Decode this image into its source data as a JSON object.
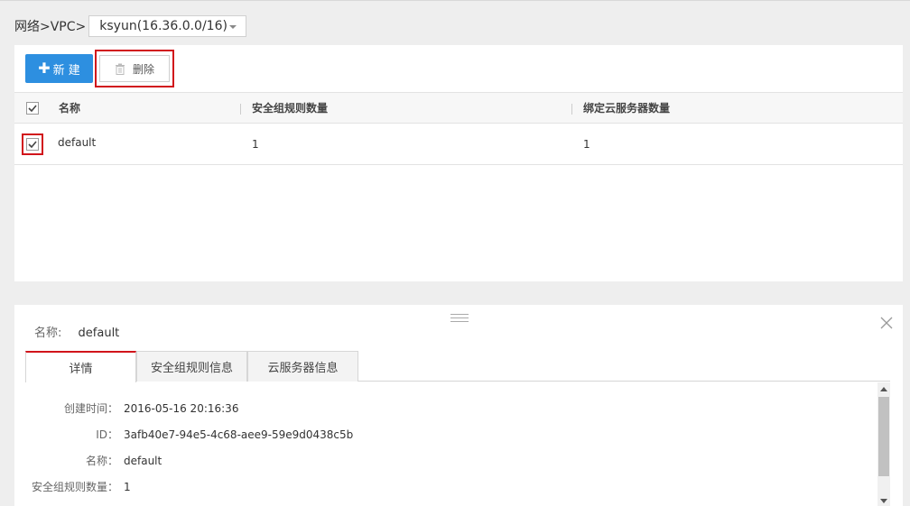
{
  "breadcrumb": {
    "text": "网络>VPC>",
    "vpc_selected": "ksyun(16.36.0.0/16)"
  },
  "toolbar": {
    "new_label": "新 建",
    "delete_label": "删除"
  },
  "table": {
    "columns": [
      "名称",
      "安全组规则数量",
      "绑定云服务器数量"
    ],
    "rows": [
      {
        "name": "default",
        "rule_count": "1",
        "server_count": "1"
      }
    ]
  },
  "detail": {
    "name_label": "名称:",
    "name_value": "default",
    "tabs": [
      "详情",
      "安全组规则信息",
      "云服务器信息"
    ],
    "fields": [
      {
        "label": "创建时间：",
        "value": "2016-05-16 20:16:36"
      },
      {
        "label": "ID：",
        "value": "3afb40e7-94e5-4c68-aee9-59e9d0438c5b"
      },
      {
        "label": "名称：",
        "value": "default"
      },
      {
        "label": "安全组规则数量：",
        "value": "1"
      }
    ]
  },
  "colors": {
    "primary": "#2d8fe0",
    "highlight": "#d1141b",
    "active_tab_border": "#d1141b"
  },
  "icons": [
    "plus-icon",
    "trash-icon",
    "chevron-down-icon",
    "checkbox-icon",
    "close-icon",
    "drag-handle-icon"
  ]
}
